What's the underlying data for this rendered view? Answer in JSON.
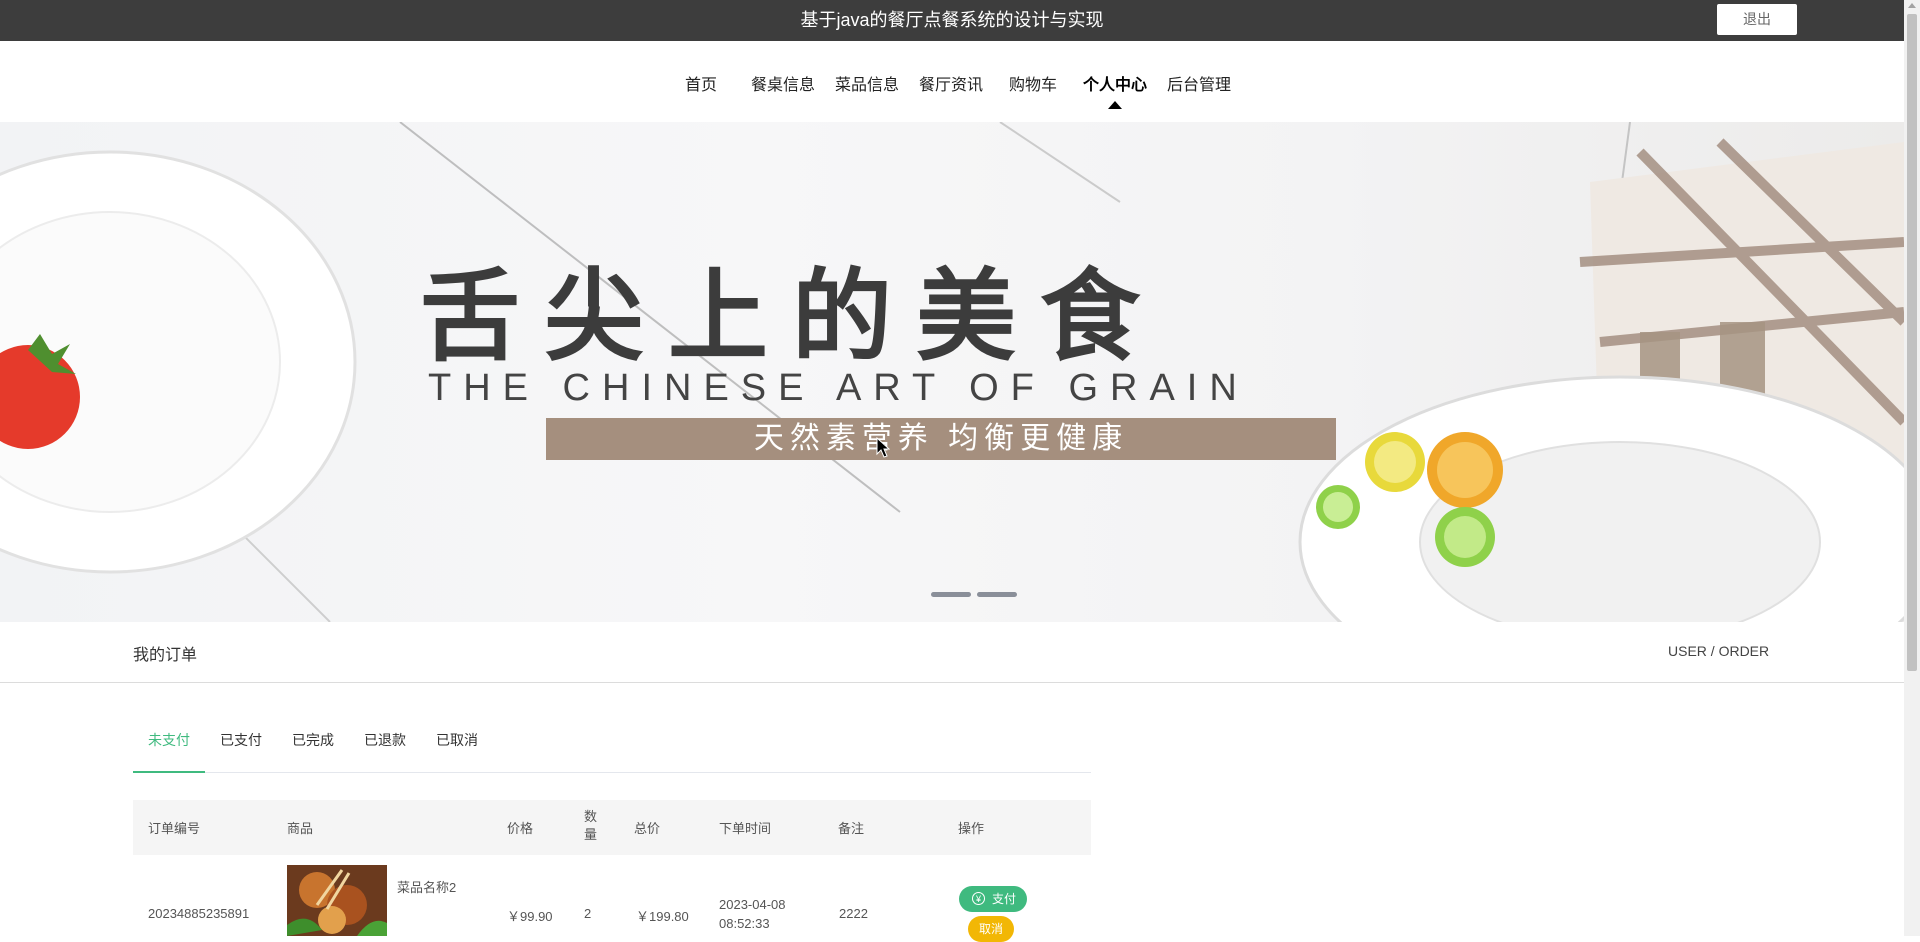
{
  "header": {
    "title": "基于java的餐厅点餐系统的设计与实现",
    "logout_label": "退出"
  },
  "nav": {
    "items": [
      {
        "label": "首页"
      },
      {
        "label": "餐桌信息"
      },
      {
        "label": "菜品信息"
      },
      {
        "label": "餐厅资讯"
      },
      {
        "label": "购物车"
      },
      {
        "label": "个人中心",
        "active": true
      },
      {
        "label": "后台管理"
      }
    ]
  },
  "banner": {
    "headline": "舌尖上的美食",
    "subtitle": "THE CHINESE ART OF GRAIN",
    "tagline": "天然素营养 均衡更健康",
    "slides": 2
  },
  "section": {
    "title": "我的订单",
    "breadcrumb": "USER / ORDER"
  },
  "tabs": [
    {
      "label": "未支付",
      "active": true
    },
    {
      "label": "已支付"
    },
    {
      "label": "已完成"
    },
    {
      "label": "已退款"
    },
    {
      "label": "已取消"
    }
  ],
  "table": {
    "columns": [
      "订单编号",
      "商品",
      "价格",
      "数\n量",
      "总价",
      "下单时间",
      "备注",
      "操作"
    ],
    "rows": [
      {
        "order_no": "20234885235891",
        "product_name": "菜品名称2",
        "price": "￥99.90",
        "quantity": "2",
        "total": "￥199.80",
        "date": "2023-04-08",
        "time": "08:52:33",
        "remark": "2222",
        "pay_label": "支付",
        "cancel_label": "取消"
      }
    ]
  },
  "colors": {
    "accent": "#3fba7f",
    "topbar": "#3d3d3d",
    "cancel": "#f2b705",
    "tagline_bg": "#a58f7e"
  }
}
